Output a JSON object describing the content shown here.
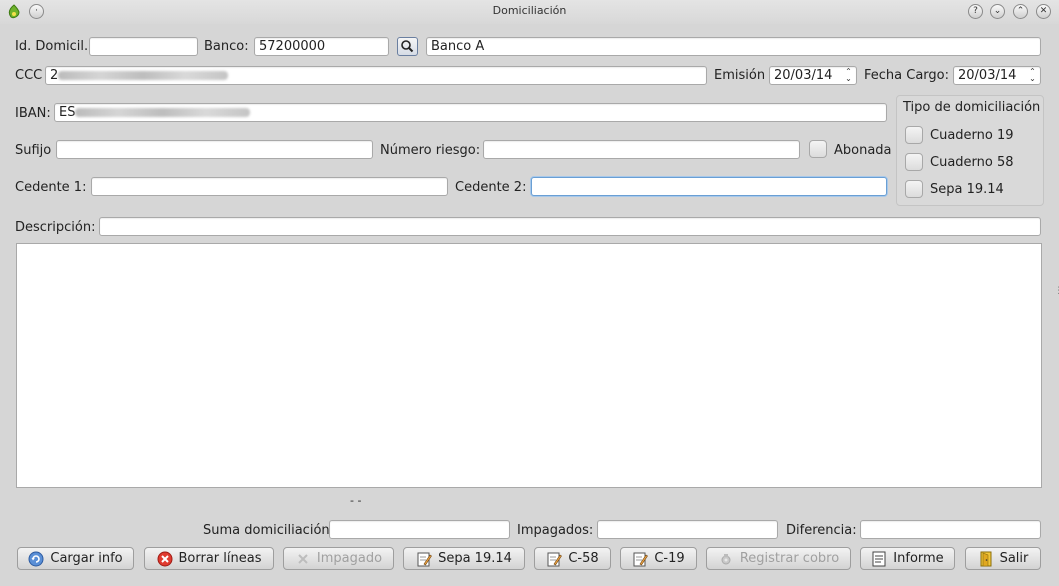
{
  "window": {
    "title": "Domiciliación"
  },
  "form": {
    "id_domicil_label": "Id. Domicil.",
    "id_domicil_value": "",
    "banco_label": "Banco:",
    "banco_value": "57200000",
    "banco_name": "Banco A",
    "ccc_label": "CCC",
    "ccc_value": "2",
    "emision_label": "Emisión",
    "emision_value": "20/03/14",
    "fecha_cargo_label": "Fecha Cargo:",
    "fecha_cargo_value": "20/03/14",
    "iban_label": "IBAN:",
    "iban_value": "ES",
    "sufijo_label": "Sufijo",
    "sufijo_value": "",
    "numero_riesgo_label": "Número riesgo:",
    "numero_riesgo_value": "",
    "abonada_label": "Abonada",
    "cedente1_label": "Cedente 1:",
    "cedente1_value": "",
    "cedente2_label": "Cedente 2:",
    "cedente2_value": "",
    "descripcion_label": "Descripción:",
    "descripcion_value": ""
  },
  "tipo": {
    "title": "Tipo de domiciliación",
    "options": [
      "Cuaderno 19",
      "Cuaderno 58",
      "Sepa 19.14"
    ]
  },
  "status_text": "- -",
  "totals": {
    "suma_label": "Suma domiciliación",
    "suma_value": "",
    "impagados_label": "Impagados:",
    "impagados_value": "",
    "diferencia_label": "Diferencia:",
    "diferencia_value": ""
  },
  "buttons": {
    "cargar": "Cargar info",
    "borrar": "Borrar líneas",
    "impagado": "Impagado",
    "sepa": "Sepa 19.14",
    "c58": "C-58",
    "c19": "C-19",
    "registrar": "Registrar cobro",
    "informe": "Informe",
    "salir": "Salir"
  },
  "icons": {
    "app": "leaf-app-icon",
    "search": "magnifier-icon",
    "cargar": "reload-icon",
    "borrar": "red-x-icon",
    "impagado": "x-disabled-icon",
    "doc": "pencil-document-icon",
    "registrar": "gear-disabled-icon",
    "informe": "report-icon",
    "salir": "exit-door-icon"
  }
}
